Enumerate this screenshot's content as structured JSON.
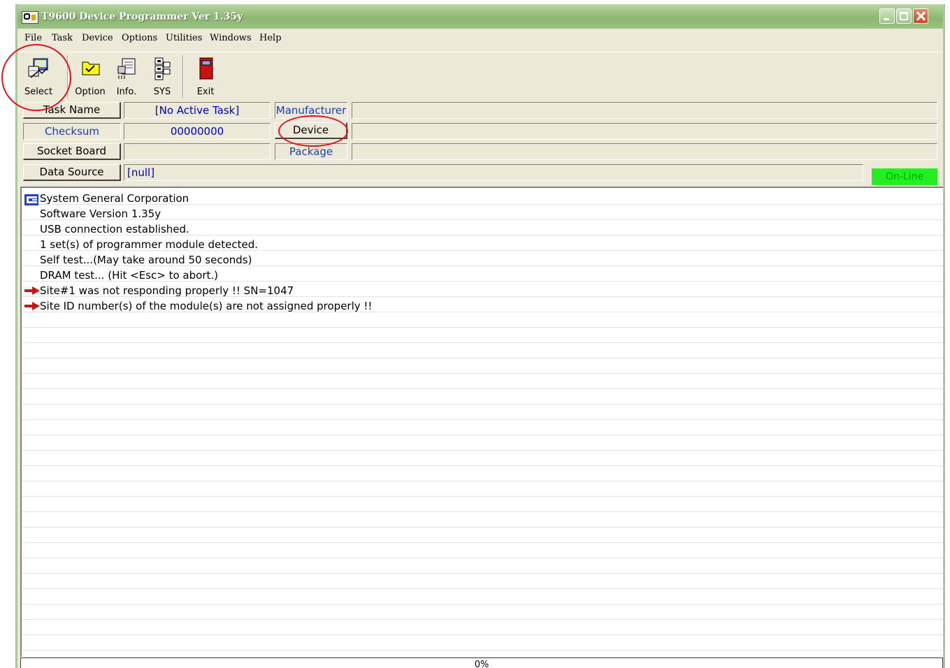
{
  "window": {
    "title": "T9600 Device Programmer Ver 1.35y"
  },
  "menu": [
    "File",
    "Task",
    "Device",
    "Options",
    "Utilities",
    "Windows",
    "Help"
  ],
  "toolbar": {
    "select": "Select",
    "option": "Option",
    "info": "Info.",
    "sys": "SYS",
    "exit": "Exit"
  },
  "info": {
    "task_name_label": "Task Name",
    "task_name_value": "[No Active Task]",
    "manufacturer_label": "Manufacturer",
    "manufacturer_value": "",
    "checksum_label": "Checksum",
    "checksum_value": "00000000",
    "device_label": "Device",
    "device_value": "",
    "socket_board_label": "Socket Board",
    "socket_board_value": "",
    "package_label": "Package",
    "package_value": "",
    "data_source_label": "Data Source",
    "data_source_value": "[null]",
    "status": "On-Line"
  },
  "log": [
    {
      "text": "System General Corporation",
      "icon": "sg-logo-icon"
    },
    {
      "text": "Software Version 1.35y",
      "icon": ""
    },
    {
      "text": "USB connection established.",
      "icon": ""
    },
    {
      "text": "1 set(s) of programmer module detected.",
      "icon": ""
    },
    {
      "text": "Self test...(May take around 50 seconds)",
      "icon": ""
    },
    {
      "text": "DRAM test... (Hit <Esc> to abort.)",
      "icon": ""
    },
    {
      "text": "Site#1 was not responding properly !! SN=1047",
      "icon": "red-arrow-icon"
    },
    {
      "text": "Site ID number(s) of the module(s) are not assigned properly !!",
      "icon": "red-arrow-icon"
    }
  ],
  "progress": {
    "label": "0%",
    "value": 0
  },
  "colors": {
    "online": "#22ee22",
    "annotation": "#e0141e",
    "titlebar": "#9cc283"
  }
}
